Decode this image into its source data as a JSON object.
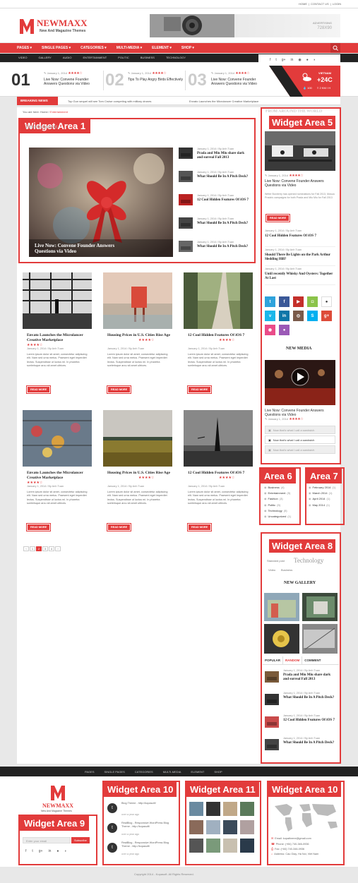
{
  "topbar": {
    "links": [
      "HOME",
      "CONTACT US",
      "LOGIN"
    ]
  },
  "header": {
    "logo_name": "NEWMAXX",
    "logo_tagline": "New And Magazine Themes",
    "ad_label": "ADVERTISING",
    "ad_size": "728X90"
  },
  "nav": {
    "items": [
      "PAGES",
      "SINGLE PAGES",
      "CATEGORIES",
      "MULTI-MEDIA",
      "ELEMENT",
      "SHOP"
    ]
  },
  "subnav": {
    "items": [
      "VIDEO",
      "GALLERY",
      "AUDIO",
      "ENTERTAINMENT",
      "POLITIC",
      "BUSINESS",
      "TECHNOLOGY"
    ]
  },
  "featured": [
    {
      "num": "01",
      "date": "January 1, 2014",
      "title": "Live Now: Convene Founder Answers Questions via Video"
    },
    {
      "num": "02",
      "date": "January 1, 2014",
      "title": "Tips To Play Angry Birds Effectively"
    },
    {
      "num": "03",
      "date": "January 1, 2014",
      "title": "Live Now: Convene Founder Answers Questions via Video"
    }
  ],
  "weather": {
    "city": "VIETNAM",
    "temp": "+24C",
    "humidity": "100",
    "wind": "2 KM / H"
  },
  "breaking": {
    "label": "BREAKING NEWS",
    "items": [
      "Top Gun sequel will see Tom Cruise competing with military drones",
      "Envato Launches the Microlancer Creative Marketplace"
    ]
  },
  "breadcrumb": {
    "prefix": "You are here:",
    "home": "Home",
    "sep": "/",
    "current": "Entertainment"
  },
  "widgets": {
    "w1": "Widget Area 1",
    "w5": "Widget Area 5",
    "w6": "Area 6",
    "w7": "Area 7",
    "w8": "Widget Area 8",
    "w9": "Widget Area 9",
    "w10": "Widget Area 10",
    "w11": "Widget Area 11",
    "w10b": "Widget Area 10"
  },
  "entertainment": {
    "heading": "Entertainment",
    "main_title": "Live Now: Convene Founder Answers Questions via Video",
    "list": [
      {
        "meta": "January 1, 2014 / By Anh Tuan",
        "title": "Prada and Miu Miu share dark and surreal Fall 2013"
      },
      {
        "meta": "January 1, 2014 / By Anh Tuan",
        "title": "What Should Be In A Pitch Deck?"
      },
      {
        "meta": "January 1, 2014 / By Anh Tuan",
        "title": "12 Cool Hidden Features Of iOS 7"
      },
      {
        "meta": "January 1, 2014 / By Anh Tuan",
        "title": "What Should Be In A Pitch Deck?"
      },
      {
        "meta": "January 1, 2014 / By Anh Tuan",
        "title": "What Should Be In A Pitch Deck?"
      }
    ]
  },
  "posts": [
    {
      "title": "Envato Launches the Microlancer Creative Marketplace",
      "meta": "January 1, 2014 / By Anh Tuan",
      "excerpt": "Lorem ipsum dolor sit amet, consectetur adipiscing elit. Nam sed urna metus. Praesent eget imperdiet lectus. Suspendisse ut luctus mi. In pharetra scelerisque arcu sit amet ultrices.",
      "button": "READ MORE"
    },
    {
      "title": "Housing Prices in U.S. Cities Rise Age",
      "meta": "January 1, 2014 / By Anh Tuan",
      "excerpt": "Lorem ipsum dolor sit amet, consectetur adipiscing elit. Nam sed urna metus. Praesent eget imperdiet lectus. Suspendisse ut luctus mi. In pharetra scelerisque arcu sit amet ultrices.",
      "button": "READ MORE"
    },
    {
      "title": "12 Cool Hidden Features Of iOS 7",
      "meta": "January 1, 2014 / By Anh Tuan",
      "excerpt": "Lorem ipsum dolor sit amet, consectetur adipiscing elit. Nam sed urna metus. Praesent eget imperdiet lectus. Suspendisse ut luctus mi. In pharetra scelerisque arcu sit amet ultrices.",
      "button": "READ MORE"
    },
    {
      "title": "Envato Launches the Microlancer Creative Marketplace",
      "meta": "January 1, 2014 / By Anh Tuan",
      "excerpt": "Lorem ipsum dolor sit amet, consectetur adipiscing elit. Nam sed urna metus. Praesent eget imperdiet lectus. Suspendisse ut luctus mi. In pharetra scelerisque arcu sit amet ultrices.",
      "button": "READ MORE"
    },
    {
      "title": "Housing Prices in U.S. Cities Rise Age",
      "meta": "January 1, 2014 / By Anh Tuan",
      "excerpt": "Lorem ipsum dolor sit amet, consectetur adipiscing elit. Nam sed urna metus. Praesent eget imperdiet lectus. Suspendisse ut luctus mi. In pharetra scelerisque arcu sit amet ultrices.",
      "button": "READ MORE"
    },
    {
      "title": "12 Cool Hidden Features Of iOS 7",
      "meta": "January 1, 2014 / By Anh Tuan",
      "excerpt": "Lorem ipsum dolor sit amet, consectetur adipiscing elit. Nam sed urna metus. Praesent eget imperdiet lectus. Suspendisse ut luctus mi. In pharetra scelerisque arcu sit amet ultrices.",
      "button": "READ MORE"
    }
  ],
  "pagination": [
    "‹",
    "1",
    "2",
    "3",
    "4",
    "›"
  ],
  "sidebar5": {
    "heading": "FROM AROUND THE WORLD",
    "date": "January 1, 2014",
    "title": "Live Now: Convene Founder Answers Questions via Video",
    "excerpt": "Writer Boxberry has opened nominations for Fall 2013, Mosca Prada's campaigns for both Prada and Miu Miu for Fall 2013",
    "button": "READ MORE",
    "list": [
      {
        "meta": "January 1, 2014 / By Anh Tuan",
        "title": "12 Cool Hidden Features Of iOS 7"
      },
      {
        "meta": "January 1, 2014 / By Anh Tuan",
        "title": "Should There Be Lights on the Park Arthur Sledding Hill?"
      },
      {
        "meta": "January 1, 2014 / By Anh Tuan",
        "title": "Until recently Whisky And Oysters: Together At Last"
      }
    ],
    "new_media": "NEW MEDIA",
    "media_title": "Live Now: Convene Founder Answers Questions via Video",
    "media_date": "January 1, 2014",
    "playlist": [
      "Now that's what I call a sandwich",
      "Now that's what I call a sandwich",
      "Now that's what I call a sandwich"
    ]
  },
  "categories": [
    {
      "name": "Business",
      "count": "(4)"
    },
    {
      "name": "Entertainment",
      "count": "(5)"
    },
    {
      "name": "Fashion",
      "count": "(3)"
    },
    {
      "name": "Politic",
      "count": "(5)"
    },
    {
      "name": "Technology",
      "count": "(5)"
    },
    {
      "name": "Uncategorized",
      "count": "(1)"
    }
  ],
  "archives": [
    {
      "name": "February 2014",
      "count": "(1)"
    },
    {
      "name": "March 2014",
      "count": "(1)"
    },
    {
      "name": "April 2014",
      "count": "(1)"
    },
    {
      "name": "May 2014",
      "count": "(1)"
    }
  ],
  "tags": {
    "items": [
      "Standard post",
      "Technology",
      "Video",
      "Business"
    ]
  },
  "gallery": {
    "heading": "NEW GALLERY"
  },
  "tabs": {
    "items": [
      "POPULAR",
      "RANDOM",
      "COMMENT"
    ],
    "posts": [
      {
        "meta": "January 1, 2014 / By Anh Tuan",
        "title": "Prada and Miu Miu share dark and surreal Fall 2013"
      },
      {
        "meta": "January 1, 2014 / By Anh Tuan",
        "title": "What Should Be In A Pitch Deck?"
      },
      {
        "meta": "January 1, 2014 / By Anh Tuan",
        "title": "12 Cool Hidden Features Of iOS 7"
      },
      {
        "meta": "January 1, 2014 / By Anh Tuan",
        "title": "What Should Be In A Pitch Deck?"
      }
    ]
  },
  "footer_nav": {
    "items": [
      "PAGES",
      "SINGLE PAGES",
      "CATEGORIES",
      "MULTI-MEDIA",
      "ELEMENT",
      "SHOP"
    ]
  },
  "footer": {
    "logo_name": "NEWMAXX",
    "logo_tagline": "New And Magazine Themes",
    "email_placeholder": "Enter your email",
    "subscribe": "Subscribe",
    "tweets": [
      {
        "text": "Blog Theme - http://kopasoft/",
        "time": "over a year ago"
      },
      {
        "text": "RealBlog - Responsive WordPress Blog Theme - http://kopasoft/",
        "time": "over a year ago"
      },
      {
        "text": "RealBlog - Responsive WordPress Blog Theme - http://kopasoft/",
        "time": "over a year ago"
      }
    ],
    "contact": [
      {
        "icon": "envelope-icon",
        "text": "Email: kopatheme@gmail.com"
      },
      {
        "icon": "phone-icon",
        "text": "Phone: (+84) 740-346-0936"
      },
      {
        "icon": "fax-icon",
        "text": "Fax: (+84) 740-346-0936"
      },
      {
        "icon": "location-icon",
        "text": "Address: Cau Giay, Ha Noi, Viet Nam"
      }
    ],
    "copyright": "Copyright 2014 - Kopasoft. All Rights Reserved."
  },
  "colors": {
    "accent": "#e23b3b",
    "dark": "#222222"
  }
}
